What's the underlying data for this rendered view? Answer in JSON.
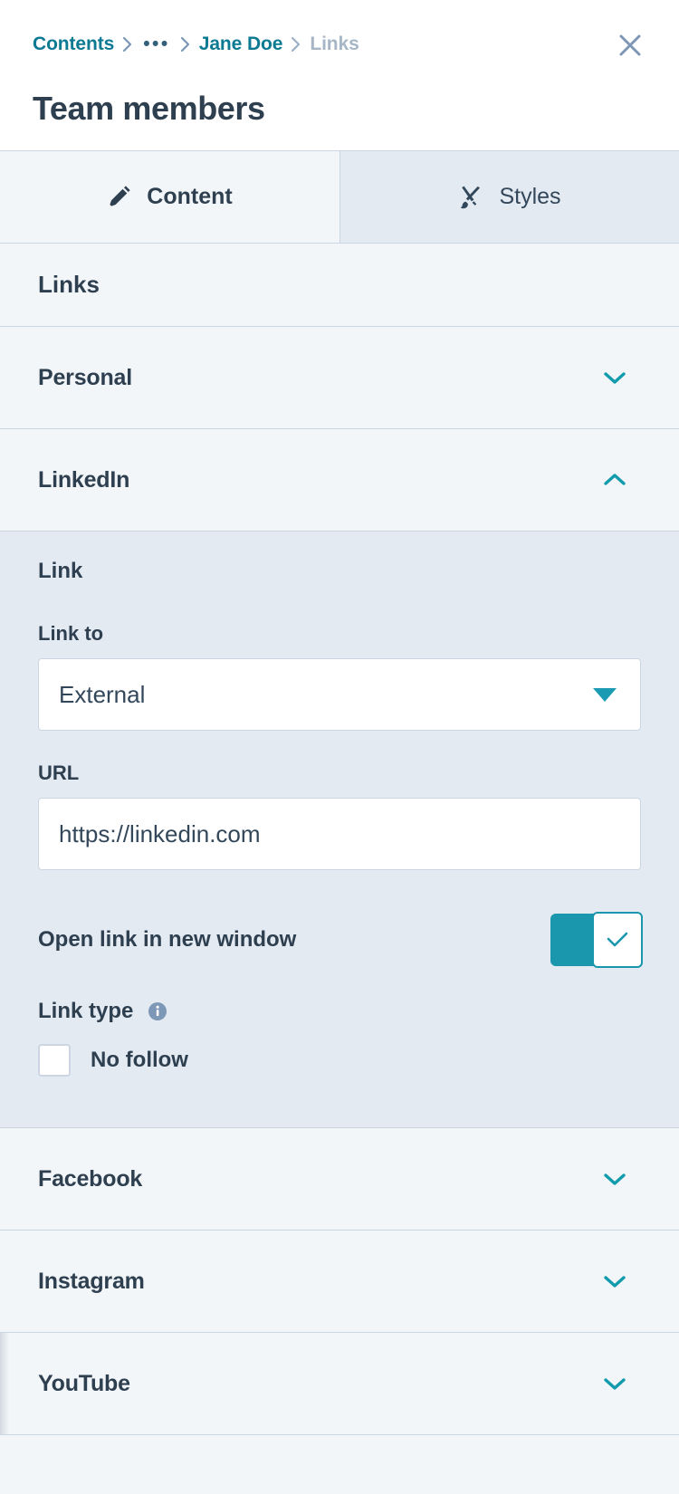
{
  "header": {
    "breadcrumb": [
      {
        "label": "Contents",
        "state": "link"
      },
      {
        "label": "•••",
        "state": "ellipsis"
      },
      {
        "label": "Jane Doe",
        "state": "link"
      },
      {
        "label": "Links",
        "state": "current"
      }
    ],
    "close_icon": "close-icon",
    "title": "Team members"
  },
  "tabs": [
    {
      "label": "Content",
      "icon": "pencil-icon",
      "active": true
    },
    {
      "label": "Styles",
      "icon": "paintbrush-icon",
      "active": false
    }
  ],
  "panel": {
    "section_title": "Links"
  },
  "accordions": [
    {
      "label": "Personal",
      "expanded": false,
      "chevron": "chevron-down-icon"
    },
    {
      "label": "LinkedIn",
      "expanded": true,
      "chevron": "chevron-up-icon"
    },
    {
      "label": "Facebook",
      "expanded": false,
      "chevron": "chevron-down-icon"
    },
    {
      "label": "Instagram",
      "expanded": false,
      "chevron": "chevron-down-icon"
    },
    {
      "label": "YouTube",
      "expanded": false,
      "chevron": "chevron-down-icon"
    }
  ],
  "linkedin_form": {
    "group_title": "Link",
    "link_to_label": "Link to",
    "link_to_value": "External",
    "link_to_options": [
      "External"
    ],
    "url_label": "URL",
    "url_value": "https://linkedin.com",
    "url_placeholder": "https://linkedin.com",
    "open_new_window_label": "Open link in new window",
    "open_new_window_checked": true,
    "link_type_label": "Link type",
    "link_type_info_icon": "info-icon",
    "no_follow_label": "No follow",
    "no_follow_checked": false
  },
  "colors": {
    "teal": "#1a96ad",
    "breadcrumb_link": "#0b7a92",
    "breadcrumb_current": "#a7b6c6",
    "text_dark": "#2e3f50",
    "panel_bg": "#f2f6f9",
    "expanded_bg": "#e3eaf2",
    "border": "#cbd6e2"
  }
}
